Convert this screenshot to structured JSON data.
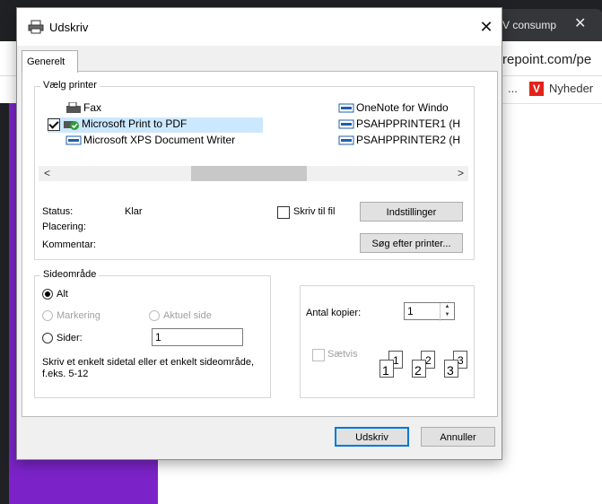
{
  "background": {
    "tab_title": "V consump",
    "url_fragment": "repoint.com/pe",
    "bookmark_more": "...",
    "bookmark_logo": "V",
    "bookmark_label": "Nyheder"
  },
  "dialog": {
    "title": "Udskriv",
    "close_glyph": "✕",
    "tab_label": "Generelt"
  },
  "printer_group": {
    "legend": "Vælg printer",
    "printers": [
      {
        "name": "Fax"
      },
      {
        "name": "Microsoft Print to PDF",
        "selected": true
      },
      {
        "name": "Microsoft XPS Document Writer"
      },
      {
        "name": "OneNote for Windo"
      },
      {
        "name": "PSAHPPRINTER1 (H"
      },
      {
        "name": "PSAHPPRINTER2 (H"
      }
    ],
    "scroll_left": "<",
    "scroll_right": ">",
    "status_label": "Status:",
    "status_value": "Klar",
    "location_label": "Placering:",
    "comment_label": "Kommentar:",
    "print_to_file_label": "Skriv til fil",
    "preferences_button": "Indstillinger",
    "find_printer_button": "Søg efter printer..."
  },
  "page_range": {
    "legend": "Sideområde",
    "all_label": "Alt",
    "selection_label": "Markering",
    "current_page_label": "Aktuel side",
    "pages_label": "Sider:",
    "pages_value": "1",
    "hint": "Skriv et enkelt sidetal eller et enkelt sideområde, f.eks. 5-12"
  },
  "copies": {
    "count_label": "Antal kopier:",
    "count_value": "1",
    "collate_label": "Sætvis",
    "page_numbers": [
      "1",
      "1",
      "2",
      "2",
      "3",
      "3"
    ]
  },
  "footer": {
    "print_button": "Udskriv",
    "cancel_button": "Annuller"
  },
  "colors": {
    "accent": "#0078d7",
    "selection": "#cce8ff",
    "background_purple": "#7b23c8"
  }
}
